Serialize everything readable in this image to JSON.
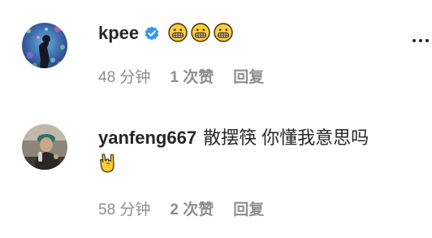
{
  "comments": [
    {
      "username": "kpee",
      "verified": true,
      "emojis": [
        "grimacing-face",
        "grimacing-face",
        "grimacing-face"
      ],
      "time": "48 分钟",
      "likes": "1 次赞",
      "reply": "回复"
    },
    {
      "username": "yanfeng667",
      "text": "散摆筷 你懂我意思吗",
      "emojis": [
        "sign-of-the-horns"
      ],
      "time": "58 分钟",
      "likes": "2 次赞",
      "reply": "回复"
    }
  ],
  "more_icon": "more-dots-icon",
  "colors": {
    "text": "#262626",
    "secondary": "#8e8e8e",
    "verified": "#3897f0",
    "emoji_yellow": "#ffcc33"
  }
}
